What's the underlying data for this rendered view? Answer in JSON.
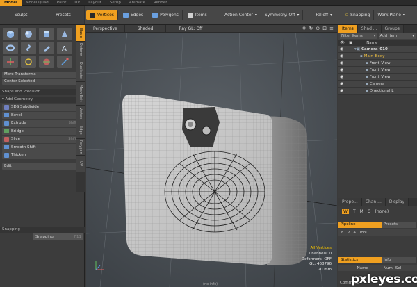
{
  "top_tabs": [
    "Model",
    "Model Quad",
    "Paint",
    "UV",
    "Layout",
    "Setup",
    "Animate",
    "Render"
  ],
  "top_tab_active": 0,
  "toolbar": {
    "left_tabs": [
      "Sculpt",
      "Presets"
    ],
    "modes": [
      {
        "label": "Vertices",
        "active": true,
        "color": "#f0a020"
      },
      {
        "label": "Edges",
        "active": false,
        "color": "#6aa0e0"
      },
      {
        "label": "Polygons",
        "active": false,
        "color": "#6aa0e0"
      },
      {
        "label": "Items",
        "active": false,
        "color": "#d0d0d0"
      }
    ],
    "action_center": "Action Center",
    "symmetry": "Symmetry: Off",
    "falloff": "Falloff",
    "snapping": "Snapping",
    "work_plane": "Work Plane"
  },
  "left": {
    "more_transforms": "More Transforms",
    "center_selected": "Center Selected",
    "snaps_precision": "Snaps and Precision",
    "add_geometry": "Add Geometry",
    "tools": [
      {
        "label": "SDS Subdivide",
        "shortcut": "",
        "color": "#7080c0"
      },
      {
        "label": "Bevel",
        "shortcut": "",
        "color": "#6090d0"
      },
      {
        "label": "Extrude",
        "shortcut": "Shift-X",
        "color": "#6090d0"
      },
      {
        "label": "Bridge",
        "shortcut": "",
        "color": "#60a060"
      },
      {
        "label": "Slice",
        "shortcut": "Shift-C",
        "color": "#c06060"
      },
      {
        "label": "Smooth Shift",
        "shortcut": "",
        "color": "#6090d0"
      },
      {
        "label": "Thicken",
        "shortcut": "",
        "color": "#6090d0"
      }
    ],
    "edit": "Edit",
    "vtabs": [
      "Basic",
      "Deform",
      "Duplicate",
      "Mesh Edit",
      "Vertex",
      "Edge",
      "Polygon",
      "UV"
    ],
    "snapping_header": "Snapping",
    "snapping_button": "Snapping",
    "snapping_shortcut": "F11"
  },
  "viewport": {
    "header": [
      "Perspective",
      "Shaded",
      "Ray GL: Off"
    ],
    "info": {
      "selection": "All Vertices",
      "channels": "Channels: 0",
      "deformers": "Deformers: OFF",
      "gl": "GL: 468796",
      "size": "20 mm"
    },
    "bottom_label": "(no info)"
  },
  "right": {
    "tabs": [
      "Items",
      "Shad ...",
      "Groups"
    ],
    "filter": "Filter Items",
    "add_item": "Add Item",
    "col_name": "Name",
    "items": [
      {
        "label": "Camera_010",
        "indent": 0,
        "bold": true
      },
      {
        "label": "Main_Body",
        "indent": 1,
        "bold": false,
        "highlight": true
      },
      {
        "label": "Front_View",
        "indent": 2,
        "bold": false
      },
      {
        "label": "Front_View",
        "indent": 2,
        "bold": false
      },
      {
        "label": "Front_View",
        "indent": 2,
        "bold": false
      },
      {
        "label": "Camera",
        "indent": 2,
        "bold": false
      },
      {
        "label": "Directional L",
        "indent": 2,
        "bold": false
      }
    ],
    "prop_tabs": [
      "Prope...",
      "Chan ...",
      "Display"
    ],
    "wtmo": [
      "W",
      "T",
      "M",
      "O"
    ],
    "none": "(none)",
    "pipeline": "Pipeline",
    "presets": "Presets",
    "pipe_cols": [
      "E",
      "V",
      "A",
      "Tool"
    ],
    "statistics": "Statistics",
    "info_tab": "Info",
    "stats_cols": [
      "Name",
      "Num",
      "Sel"
    ],
    "command": "Command"
  },
  "watermark": "pxleyes.com"
}
